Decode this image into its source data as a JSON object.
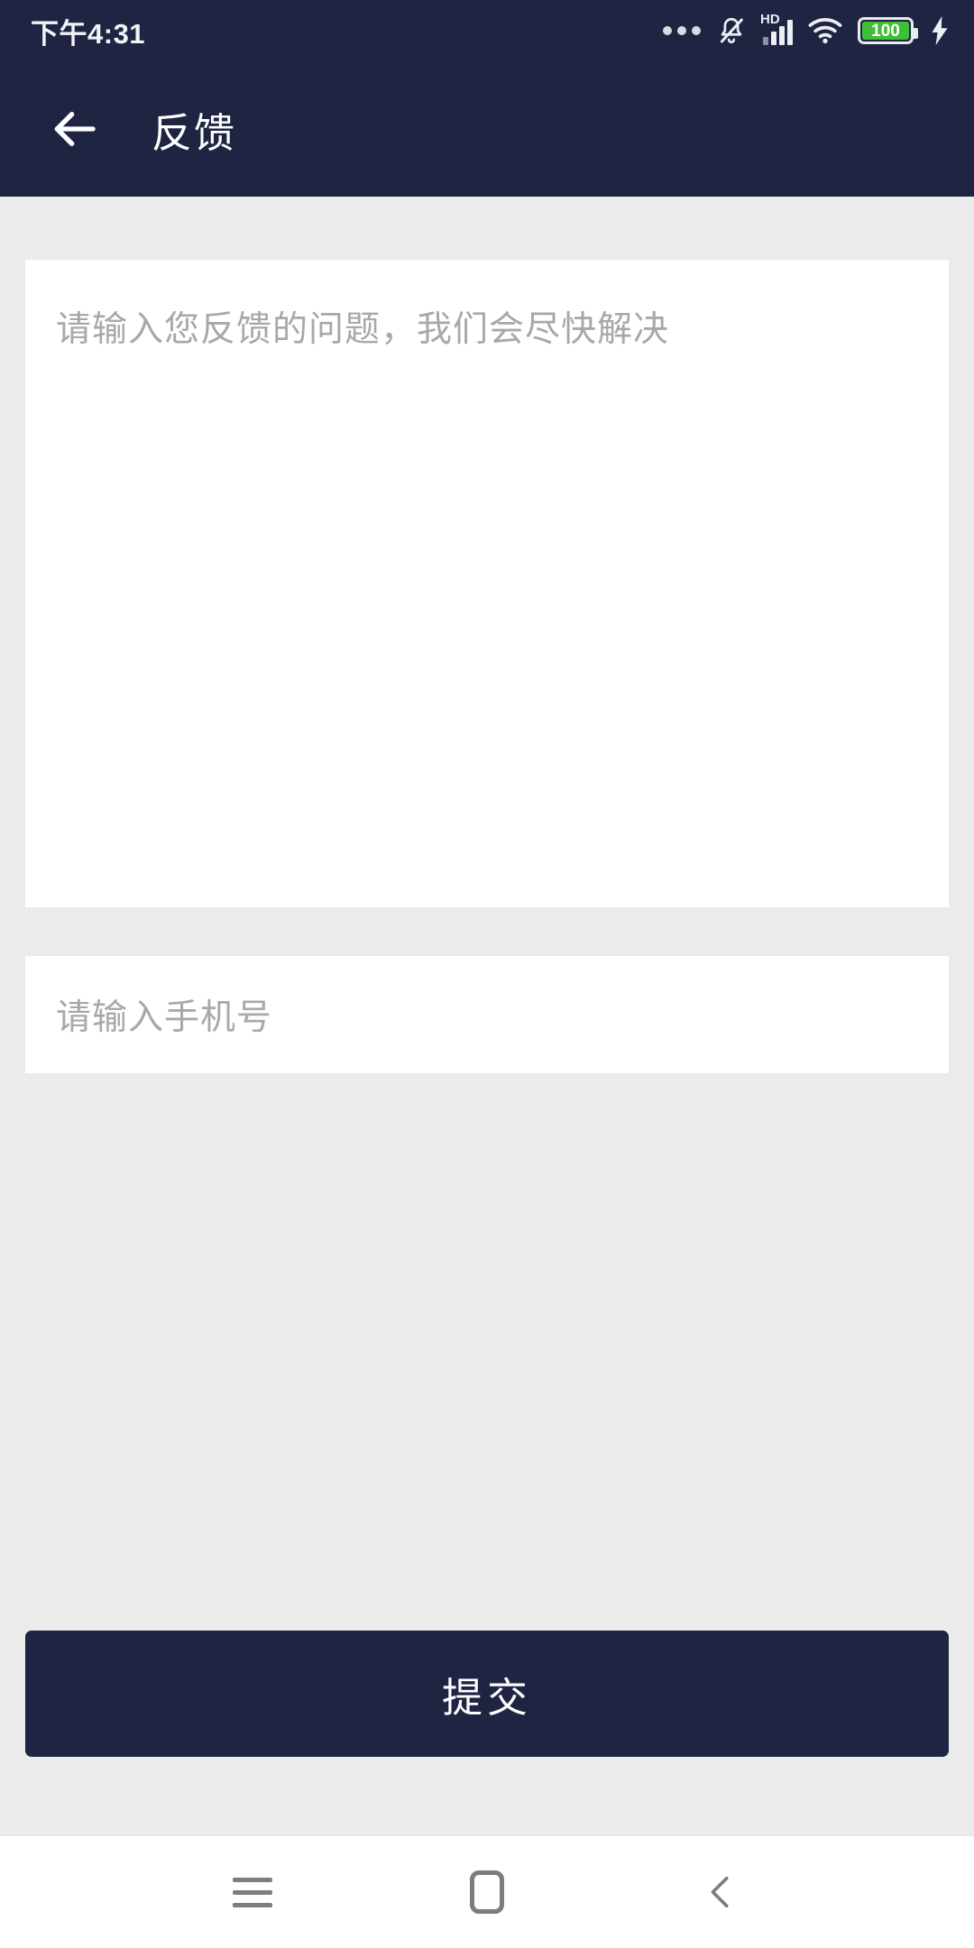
{
  "theme": {
    "header_color": "#1e2442",
    "page_bg": "#ebebeb",
    "card_bg": "#ffffff",
    "placeholder_color": "#a8a8a8",
    "battery_fill": "#3fbf34",
    "nav_icon_color": "#7d7d7d"
  },
  "status_bar": {
    "time": "下午4:31",
    "battery_level": "100",
    "icons": [
      "more-dots-icon",
      "bell-muted-icon",
      "hd-signal-icon",
      "wifi-icon",
      "battery-icon",
      "charging-bolt-icon"
    ]
  },
  "app_bar": {
    "back_icon": "arrow-left-icon",
    "title": "反馈"
  },
  "form": {
    "feedback": {
      "placeholder": "请输入您反馈的问题，我们会尽快解决",
      "value": ""
    },
    "phone": {
      "placeholder": "请输入手机号",
      "value": ""
    },
    "submit_label": "提交"
  },
  "nav_bar": {
    "recents_icon": "menu-icon",
    "home_icon": "home-square-icon",
    "back_icon": "chevron-left-icon"
  }
}
